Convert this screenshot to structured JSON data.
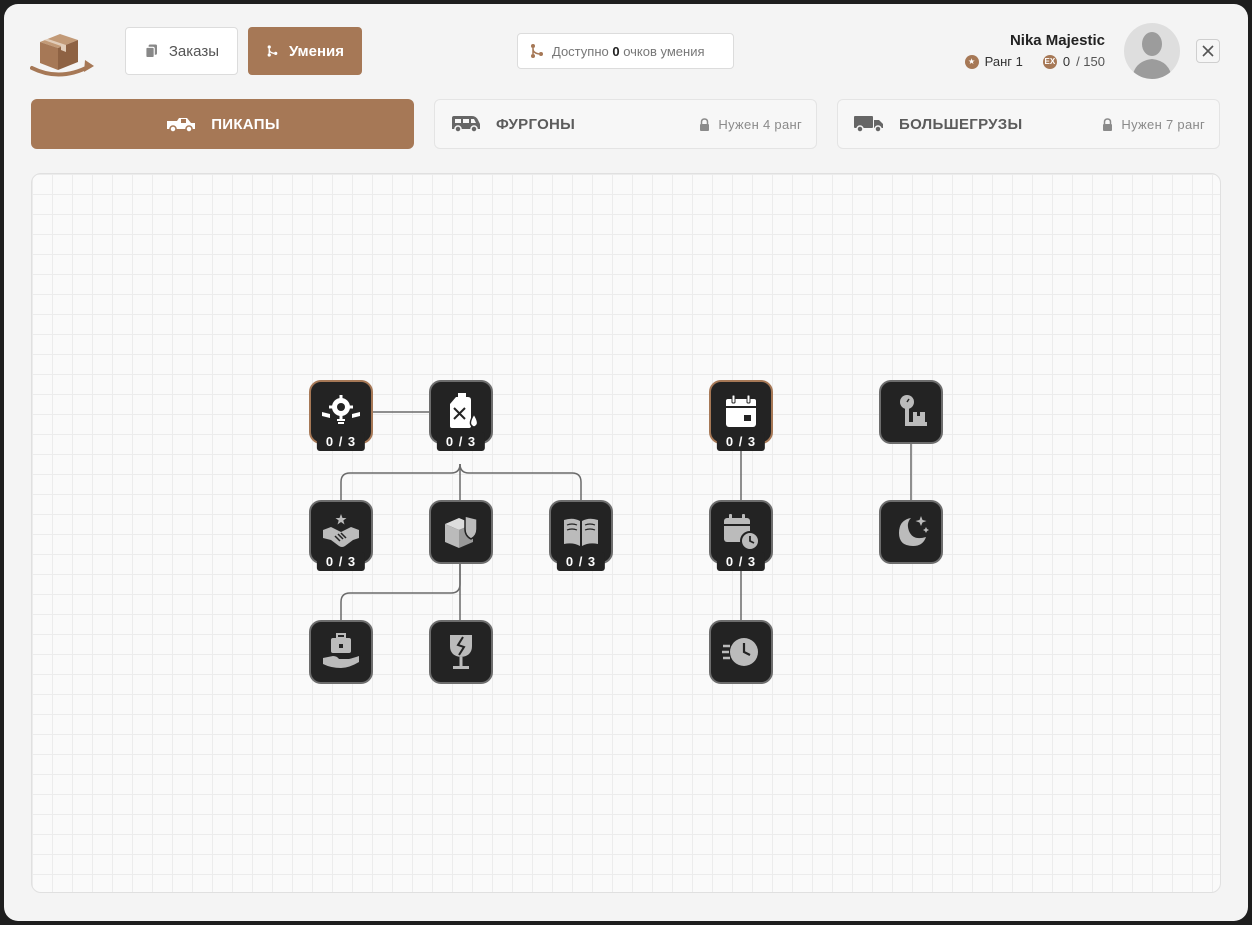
{
  "header": {
    "orders_label": "Заказы",
    "skills_label": "Умения",
    "points": {
      "prefix": "Доступно",
      "value": "0",
      "suffix": "очков умения"
    }
  },
  "user": {
    "name": "Nika Majestic",
    "rank_label": "Ранг 1",
    "exp_badge": "EX",
    "exp_current": "0",
    "exp_max": "/ 150"
  },
  "vehicle_tabs": [
    {
      "label": "ПИКАПЫ",
      "icon": "pickup-truck-icon",
      "selected": true
    },
    {
      "label": "ФУРГОНЫ",
      "icon": "van-icon",
      "locked": true,
      "lock_text": "Нужен 4 ранг"
    },
    {
      "label": "БОЛЬШЕГРУЗЫ",
      "icon": "heavy-truck-icon",
      "locked": true,
      "lock_text": "Нужен 7 ранг"
    }
  ],
  "skills": {
    "repair": {
      "icon": "wrench-gear-icon",
      "progress": "0 / 3",
      "active": true
    },
    "fuel": {
      "icon": "fuel-canister-icon",
      "progress": "0 / 3"
    },
    "deal": {
      "icon": "handshake-icon",
      "progress": "0 / 3"
    },
    "protect": {
      "icon": "box-shield-icon"
    },
    "knowledge": {
      "icon": "open-book-icon",
      "progress": "0 / 3"
    },
    "service": {
      "icon": "hand-briefcase-icon"
    },
    "fragile": {
      "icon": "fragile-glass-icon"
    },
    "schedule": {
      "icon": "calendar-icon",
      "progress": "0 / 3",
      "active": true
    },
    "timing": {
      "icon": "calendar-clock-icon",
      "progress": "0 / 3"
    },
    "express": {
      "icon": "fast-clock-icon"
    },
    "weight": {
      "icon": "scale-box-icon"
    },
    "night": {
      "icon": "moon-stars-icon"
    }
  },
  "colors": {
    "accent": "#a67856",
    "node_bg": "#232323",
    "node_border": "#6d6d6d",
    "link": "#6a6a6a"
  }
}
